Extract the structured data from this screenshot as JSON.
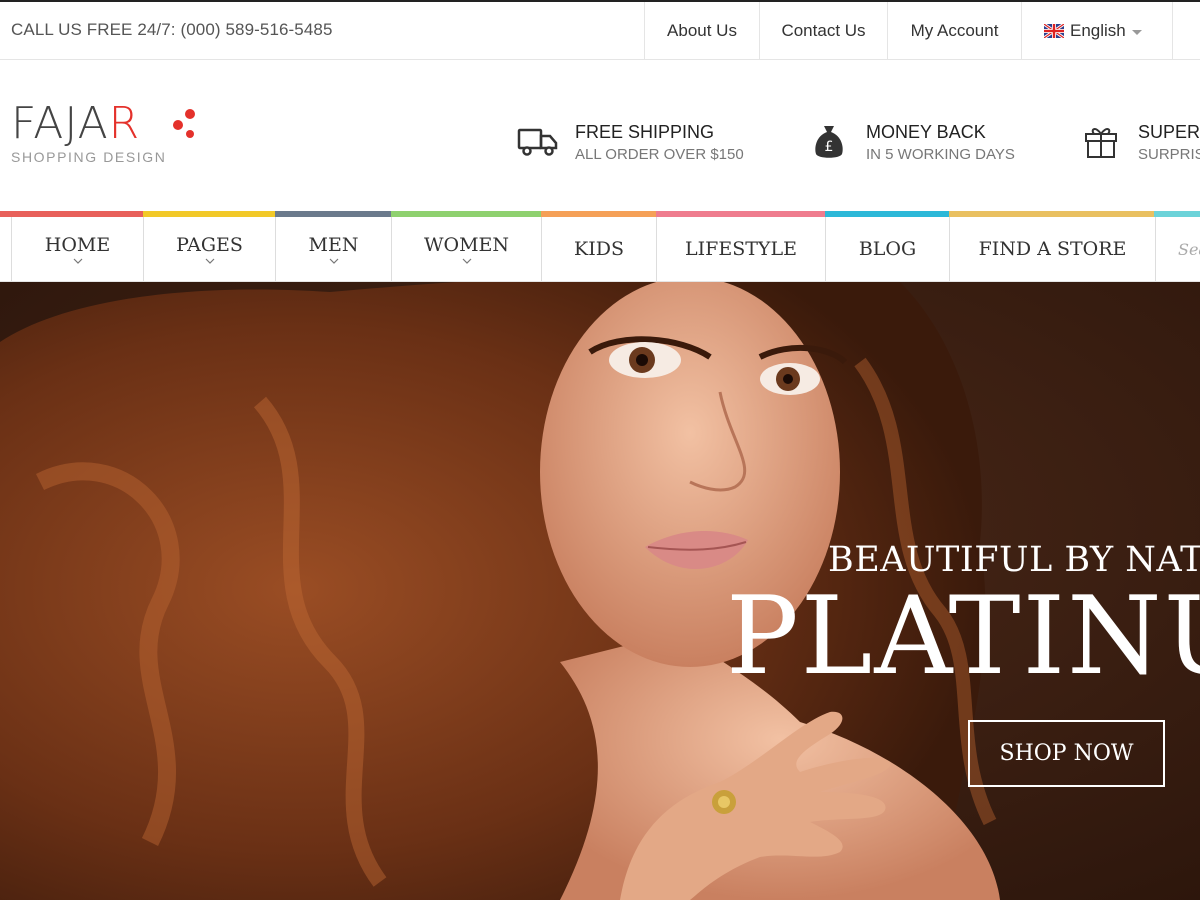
{
  "topbar": {
    "call": "CALL US FREE 24/7: (000) 589-516-5485",
    "links": [
      "About Us",
      "Contact Us",
      "My Account"
    ],
    "language": "English"
  },
  "logo": {
    "name_prefix": "FAJA",
    "name_r": "R",
    "tagline": "SHOPPING DESIGN"
  },
  "features": [
    {
      "title": "FREE SHIPPING",
      "subtitle": "ALL ORDER OVER $150",
      "icon": "truck-icon"
    },
    {
      "title": "MONEY BACK",
      "subtitle": "IN 5 WORKING DAYS",
      "icon": "money-bag-icon"
    },
    {
      "title": "SUPERB",
      "subtitle": "SURPRISE",
      "icon": "gift-icon"
    }
  ],
  "nav": {
    "items": [
      "HOME",
      "PAGES",
      "MEN",
      "WOMEN",
      "KIDS",
      "LIFESTYLE",
      "BLOG",
      "FIND A STORE"
    ],
    "search_placeholder": "Sea"
  },
  "colors": {
    "bar": [
      "#e8605a",
      "#f2c928",
      "#6b7a8c",
      "#8fd16f",
      "#f5a057",
      "#ef7c8e",
      "#2cb8d8",
      "#e9c060",
      "#6cd3d9"
    ],
    "accent": "#e4312b"
  },
  "hero": {
    "subline": "BEAUTIFUL BY NATURE",
    "headline": "PLATINUM",
    "button": "SHOP NOW"
  }
}
